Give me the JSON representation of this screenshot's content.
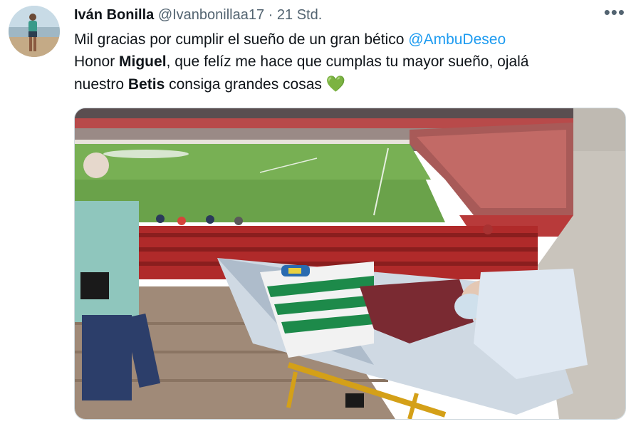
{
  "author": {
    "display_name": "Iván Bonilla",
    "handle": "@Ivanbonillaa17",
    "separator": "·",
    "time": "21 Std."
  },
  "menu": {
    "more_label": "•••"
  },
  "tweet": {
    "line1_text": "Mil gracias por cumplir el sueño de un gran bético ",
    "mention": "@AmbuDeseo",
    "line2_prefix": "Honor ",
    "line2_bold": "Miguel",
    "line2_rest": ", que felíz me hace que cumplas tu mayor sueño, ojalá",
    "line3_prefix": "nuestro ",
    "line3_bold": "Betis",
    "line3_rest": " consiga grandes cosas ",
    "emoji": "💚"
  },
  "colors": {
    "mention": "#1d9bf0",
    "meta": "#536471",
    "heart": "#3aa845"
  },
  "icons": {
    "more": "more-options-icon",
    "heart": "green-heart-icon"
  }
}
